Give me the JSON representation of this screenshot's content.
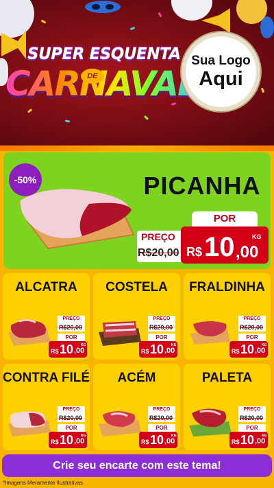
{
  "header": {
    "title_top": "SUPER ESQUENTA",
    "title_connector": "DE",
    "title_main": "CARNAVAL",
    "logo_line1": "Sua Logo",
    "logo_line2": "Aqui"
  },
  "featured": {
    "discount_badge": "-50%",
    "name": "PICANHA",
    "preco_label": "PREÇO",
    "old_price": "R$20,00",
    "por_label": "POR",
    "currency": "R$",
    "price_int": "10",
    "price_dec": ",00",
    "unit": "KG"
  },
  "products": [
    {
      "name": "ALCATRA",
      "preco_label": "PREÇO",
      "old_price": "R$20,00",
      "por_label": "POR",
      "currency": "R$",
      "price_int": "10",
      "price_dec": ",00",
      "unit": "KG"
    },
    {
      "name": "COSTELA",
      "preco_label": "PREÇO",
      "old_price": "R$20,00",
      "por_label": "POR",
      "currency": "R$",
      "price_int": "10",
      "price_dec": ",00",
      "unit": "KG"
    },
    {
      "name": "FRALDINHA",
      "preco_label": "PREÇO",
      "old_price": "R$20,00",
      "por_label": "POR",
      "currency": "R$",
      "price_int": "10",
      "price_dec": ",00",
      "unit": "KG"
    },
    {
      "name": "CONTRA FILÉ",
      "preco_label": "PREÇO",
      "old_price": "R$20,00",
      "por_label": "POR",
      "currency": "R$",
      "price_int": "10",
      "price_dec": ",00",
      "unit": "KG"
    },
    {
      "name": "ACÉM",
      "preco_label": "PREÇO",
      "old_price": "R$20,00",
      "por_label": "POR",
      "currency": "R$",
      "price_int": "10",
      "price_dec": ",00",
      "unit": "KG"
    },
    {
      "name": "PALETA",
      "preco_label": "PREÇO",
      "old_price": "R$20,00",
      "por_label": "POR",
      "currency": "R$",
      "price_int": "10",
      "price_dec": ",00",
      "unit": "KG"
    }
  ],
  "cta": {
    "label": "Crie seu encarte com este tema!"
  },
  "footer": {
    "disclaimer": "*Imagens Meramente Ilustrativas"
  },
  "colors": {
    "accent_purple": "#8e1fbf",
    "price_red": "#d30018",
    "featured_green": "#7ed321",
    "card_yellow": "#ffd000",
    "background_orange": "#f7b400",
    "header_red": "#8a0f18"
  },
  "icons": [
    "carnival-mask-icon",
    "trumpet-icon",
    "confetti-icon",
    "meat-on-board-icon"
  ]
}
